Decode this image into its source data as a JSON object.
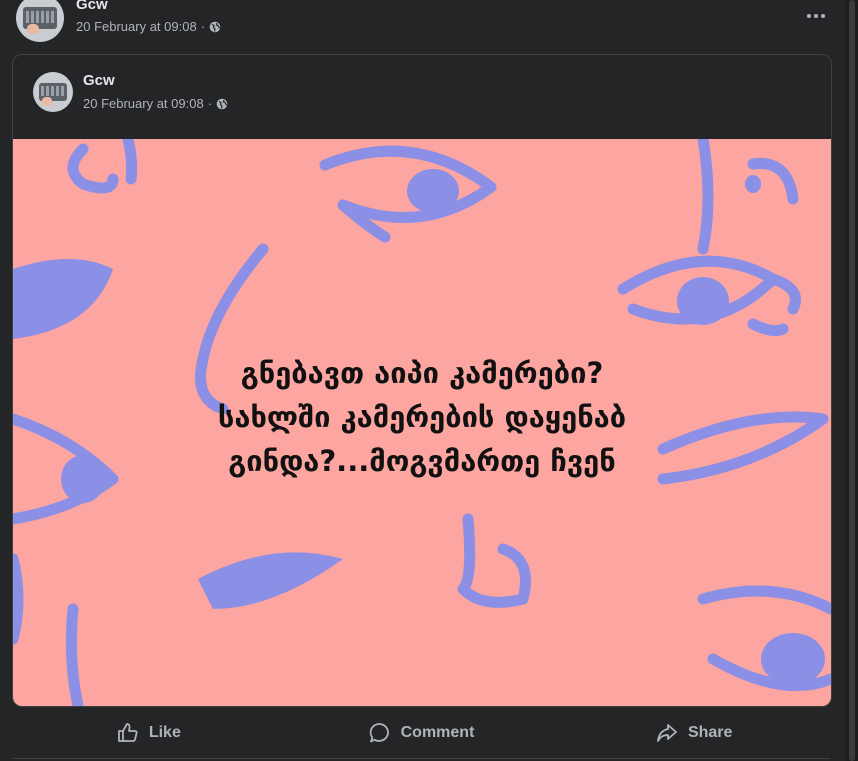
{
  "post": {
    "author": "Gcw",
    "timestamp": "20 February at 09:08",
    "privacy_icon": "globe-icon",
    "more_icon": "more-options-icon"
  },
  "shared_post": {
    "author": "Gcw",
    "timestamp": "20 February at 09:08",
    "privacy_icon": "globe-icon",
    "image": {
      "background_color": "#fda5a0",
      "doodle_color": "#8b8fe6",
      "text_lines": [
        "გნებავთ აიპი კამერები?",
        "სახლში კამერების დაყენაბ",
        "გინდა?...მოგვმართე ჩვენ"
      ]
    }
  },
  "actions": {
    "like": "Like",
    "comment": "Comment",
    "share": "Share"
  },
  "colors": {
    "background": "#242526",
    "text_primary": "#e4e6eb",
    "text_secondary": "#b0b3b8"
  }
}
